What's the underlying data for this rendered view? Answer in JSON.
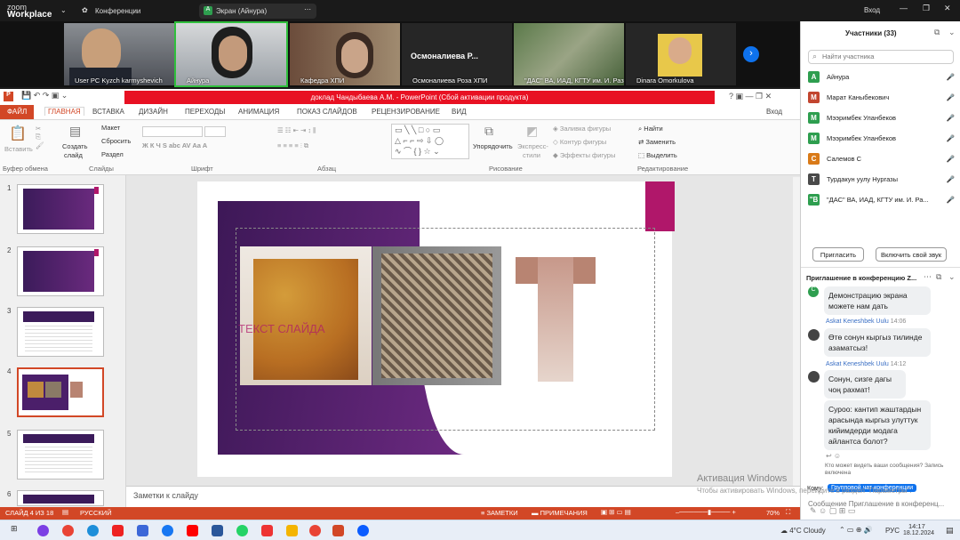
{
  "zoom": {
    "logo_top": "zoom",
    "logo_bottom": "Workplace",
    "meeting_label": "Конференции",
    "share_label": "Экран (Айнура)",
    "share_avatar": "A",
    "signin": "Вход"
  },
  "videos": [
    {
      "name": "User PC Kyzch karmyshevich"
    },
    {
      "name": "Айнура"
    },
    {
      "name": "Кафедра ХПИ"
    },
    {
      "name": "Осмоналиева Роза ХПИ",
      "big": "Осмоналиева Р..."
    },
    {
      "name": "\"ДАС\" ВА, ИАД, КГТУ им. И. Раз..."
    },
    {
      "name": "Dinara Omorkulova"
    }
  ],
  "panel": {
    "title": "Участники (33)",
    "search_placeholder": "Найти участника",
    "participants": [
      {
        "initial": "A",
        "name": "Айнура",
        "color": "#2e9e4f"
      },
      {
        "initial": "М",
        "name": "Марат Каныбекович",
        "color": "#c2452f"
      },
      {
        "initial": "M",
        "name": "Мээримбек Уланбеков",
        "color": "#2e9e4f"
      },
      {
        "initial": "M",
        "name": "Мээримбек Уланбеков",
        "color": "#2e9e4f"
      },
      {
        "initial": "С",
        "name": "Салемов С",
        "color": "#d97a18"
      },
      {
        "initial": "Т",
        "name": "Турдакун уулу Нургазы",
        "color": "#4a4a4a"
      },
      {
        "initial": "\"В",
        "name": "\"ДАС\" ВА, ИАД, КГТУ им. И. Ра...",
        "color": "#2e9e4f"
      }
    ],
    "invite_btn": "Пригласить",
    "unmute_btn": "Включить свой звук",
    "chat_title": "Приглашение в конференцию Z...",
    "chat": [
      {
        "text": "Демонстрацию экрана можете нам дать"
      },
      {
        "sender": "Askat Keneshbek Uulu",
        "time": "14:06",
        "text": "Өтө сонун кыргыз тилинде азаматсыз!"
      },
      {
        "sender": "Askat Keneshbek Uulu",
        "time": "14:12",
        "text": "Сонун, сизге дагы чоң рахмат!"
      },
      {
        "text": "Суроо: кантип жаштардын арасында кыргыз улуттук кийимдерди модага айлантса болот?"
      }
    ],
    "who_sees": "Кто может видеть ваши сообщения? Запись включена",
    "to_label": "Кому:",
    "to_value": "Групповой чат конференции",
    "input_placeholder": "Сообщение Приглашение в конференц...",
    "activate1": "Активация Windows",
    "activate2": "Чтобы активировать Windows, перейдите в раздел \"Параметры\"."
  },
  "ppt": {
    "title": "доклад Чандыбаева А.М. -  PowerPoint (Сбой активации продукта)",
    "signin": "Вход",
    "tabs": [
      "ФАЙЛ",
      "ГЛАВНАЯ",
      "ВСТАВКА",
      "ДИЗАЙН",
      "ПЕРЕХОДЫ",
      "АНИМАЦИЯ",
      "ПОКАЗ СЛАЙДОВ",
      "РЕЦЕНЗИРОВАНИЕ",
      "ВИД"
    ],
    "groups": {
      "clipboard": "Буфер обмена",
      "slides": "Слайды",
      "font": "Шрифт",
      "paragraph": "Абзац",
      "drawing": "Рисование",
      "editing": "Редактирование"
    },
    "buttons": {
      "paste": "Вставить",
      "create": "Создать",
      "slide": "слайд",
      "layout": "Макет",
      "reset": "Сбросить",
      "section": "Раздел",
      "arrange": "Упорядочить",
      "express1": "Экспресс-",
      "express2": "стили",
      "fill": "Заливка фигуры",
      "outline": "Контур фигуры",
      "effects": "Эффекты фигуры",
      "find": "Найти",
      "replace": "Заменить",
      "select": "Выделить"
    },
    "slide_numbers": [
      "1",
      "2",
      "3",
      "4",
      "5",
      "6"
    ],
    "slide_text": "ТЕКСТ СЛАЙДА",
    "notes": "Заметки к слайду",
    "status": {
      "slide": "СЛАЙД 4 ИЗ 18",
      "lang": "РУССКИЙ",
      "notes": "ЗАМЕТКИ",
      "comments": "ПРИМЕЧАНИЯ",
      "zoom": "70%"
    }
  },
  "taskbar": {
    "weather": "4°C  Cloudy",
    "lang": "РУС",
    "time": "14:17",
    "date": "18.12.2024"
  }
}
